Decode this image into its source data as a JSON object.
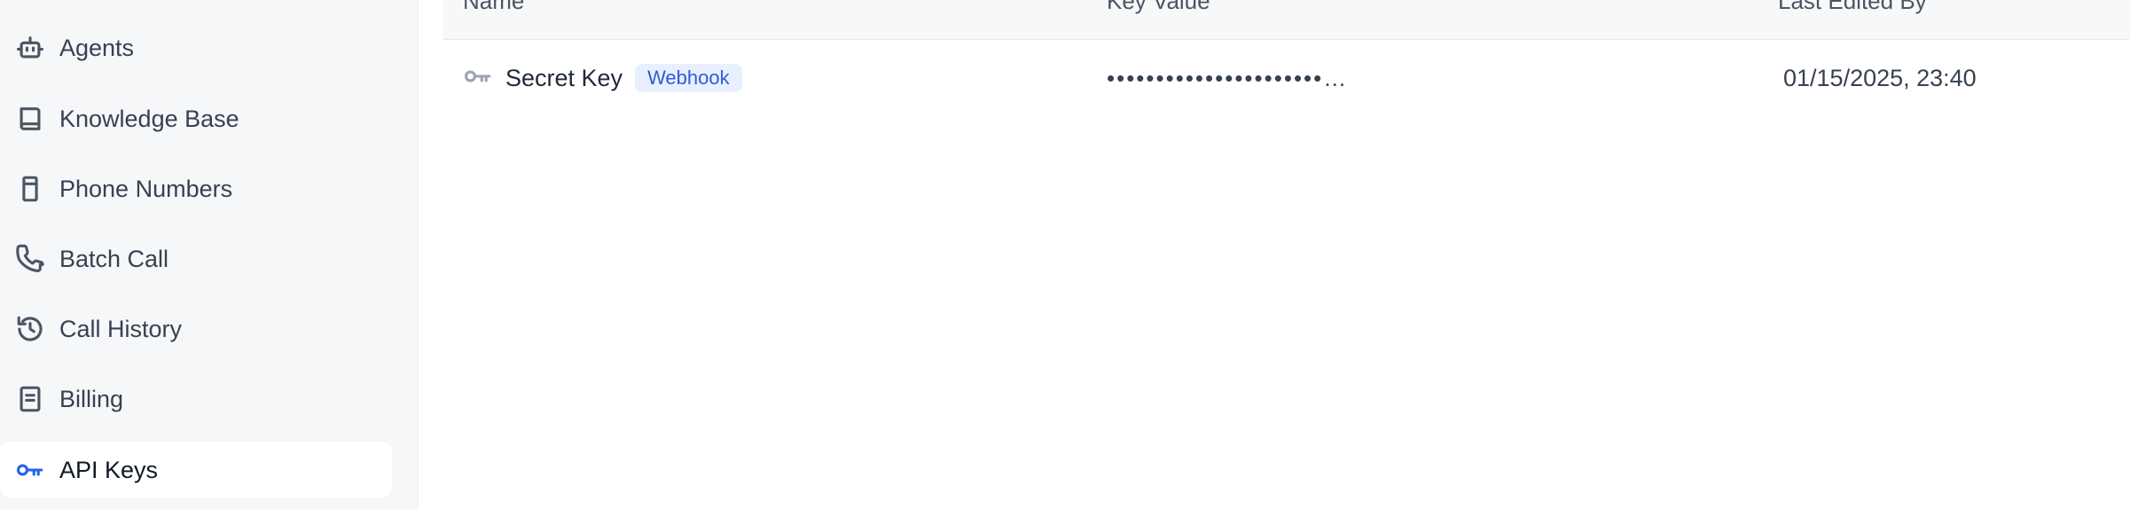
{
  "sidebar": {
    "items": [
      {
        "label": "Agents",
        "icon": "robot-icon"
      },
      {
        "label": "Knowledge Base",
        "icon": "book-icon"
      },
      {
        "label": "Phone Numbers",
        "icon": "phone-device-icon"
      },
      {
        "label": "Batch Call",
        "icon": "phone-icon"
      },
      {
        "label": "Call History",
        "icon": "history-icon"
      },
      {
        "label": "Billing",
        "icon": "receipt-icon"
      },
      {
        "label": "API Keys",
        "icon": "key-icon",
        "active": true
      }
    ]
  },
  "table": {
    "columns": [
      "Name",
      "Key Value",
      "Last Edited By"
    ],
    "rows": [
      {
        "name": "Secret Key",
        "badge": "Webhook",
        "key_value": "••••••••••••••••••••••…",
        "last_edited": "01/15/2025, 23:40"
      }
    ]
  },
  "colors": {
    "accent": "#2563eb",
    "sidebar_bg": "#f6f7f9",
    "badge_bg": "#e8efff",
    "badge_text": "#2f5bd6"
  }
}
